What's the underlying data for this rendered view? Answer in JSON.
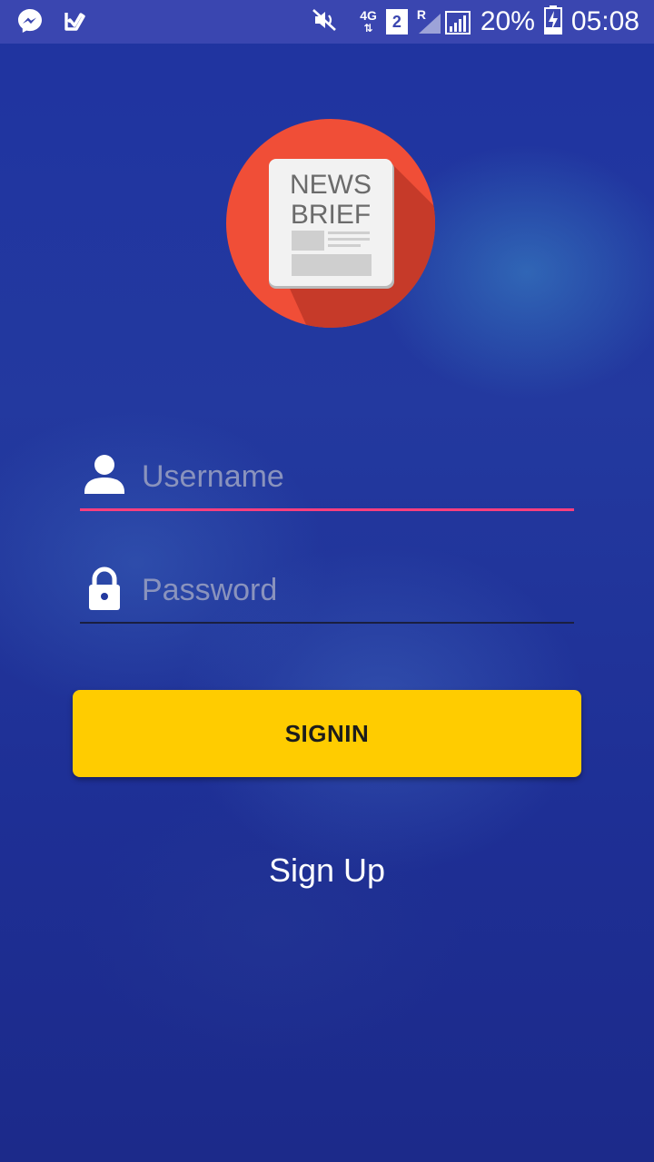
{
  "status_bar": {
    "network": "4G",
    "sim": "2",
    "roaming": "R",
    "battery": "20%",
    "time": "05:08",
    "icons": [
      "messenger-icon",
      "check-notification-icon",
      "mute-icon",
      "signal-icon",
      "battery-charging-icon"
    ]
  },
  "logo": {
    "line1": "NEWS",
    "line2": "BRIEF"
  },
  "form": {
    "username_placeholder": "Username",
    "password_placeholder": "Password",
    "username_icon": "person-icon",
    "password_icon": "lock-icon"
  },
  "actions": {
    "signin_label": "SIGNIN",
    "signup_label": "Sign Up"
  },
  "colors": {
    "accent_underline": "#ff3f7e",
    "button": "#ffcc00",
    "logo_circle": "#f04e37",
    "background": "#1f33a0"
  }
}
